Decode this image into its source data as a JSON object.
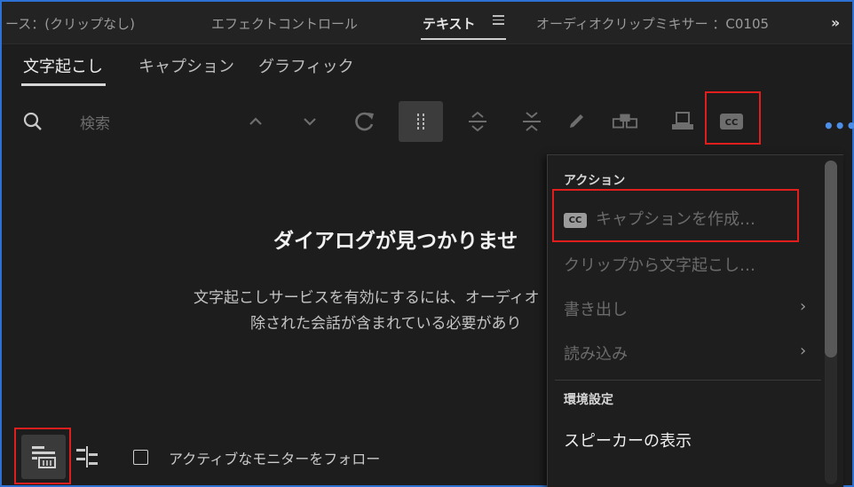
{
  "panel_tabs": [
    {
      "label": "ース：(クリップなし)"
    },
    {
      "label": "エフェクトコントロール"
    },
    {
      "label": "テキスト"
    },
    {
      "label": "オーディオクリップミキサー ：C0105"
    }
  ],
  "subtabs": [
    {
      "label": "文字起こし"
    },
    {
      "label": "キャプション"
    },
    {
      "label": "グラフィック"
    }
  ],
  "search": {
    "placeholder": "検索"
  },
  "empty_state": {
    "title": "ダイアログが見つかりませ",
    "line1": "文字起こしサービスを有効にするには、オーディオ",
    "line2": "除された会話が含まれている必要があり"
  },
  "bottom": {
    "follow_label": "アクティブなモニターをフォロー",
    "follow_checked": false
  },
  "menu": {
    "section_action": "アクション",
    "create_captions": "キャプションを作成…",
    "cc_badge": "CC",
    "transcribe_clip": "クリップから文字起こし…",
    "export": "書き出し",
    "import": "読み込み",
    "section_prefs": "環境設定",
    "show_speakers": "スピーカーの表示"
  },
  "toolbar": {
    "cc_label": "CC"
  },
  "colors": {
    "highlight": "#e01e1e",
    "accent": "#2d72d2",
    "dots": "#4d8fe8"
  }
}
